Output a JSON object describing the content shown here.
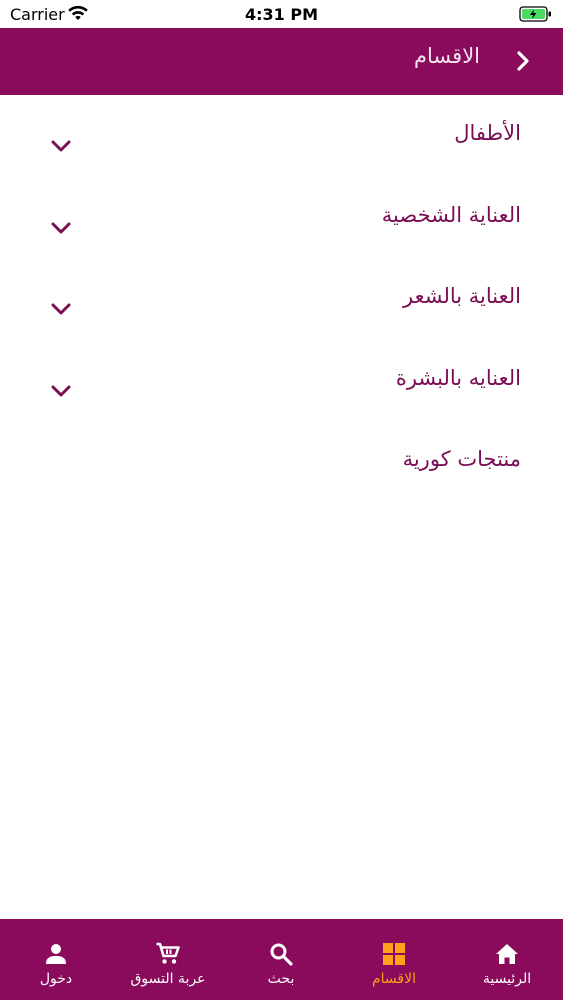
{
  "status_bar": {
    "carrier": "Carrier",
    "time": "4:31 PM"
  },
  "header": {
    "title": "الاقسام",
    "back_icon": "chevron-right-icon"
  },
  "categories": [
    {
      "label": "الأطفال",
      "expandable": true
    },
    {
      "label": "العناية الشخصية",
      "expandable": true
    },
    {
      "label": "العناية بالشعر",
      "expandable": true
    },
    {
      "label": "العنايه بالبشرة",
      "expandable": true
    },
    {
      "label": "منتجات كورية",
      "expandable": false
    }
  ],
  "tab_bar": {
    "tabs": [
      {
        "label": "الرئيسية",
        "icon": "home-icon",
        "active": false
      },
      {
        "label": "الاقسام",
        "icon": "grid-icon",
        "active": true
      },
      {
        "label": "بحث",
        "icon": "search-icon",
        "active": false
      },
      {
        "label": "عربة التسوق",
        "icon": "cart-icon",
        "active": false
      },
      {
        "label": "دخول",
        "icon": "person-icon",
        "active": false
      }
    ]
  },
  "colors": {
    "brand": "#8a0a5c",
    "active_tab": "#ff9f1c",
    "category_text": "#7a0f54"
  }
}
